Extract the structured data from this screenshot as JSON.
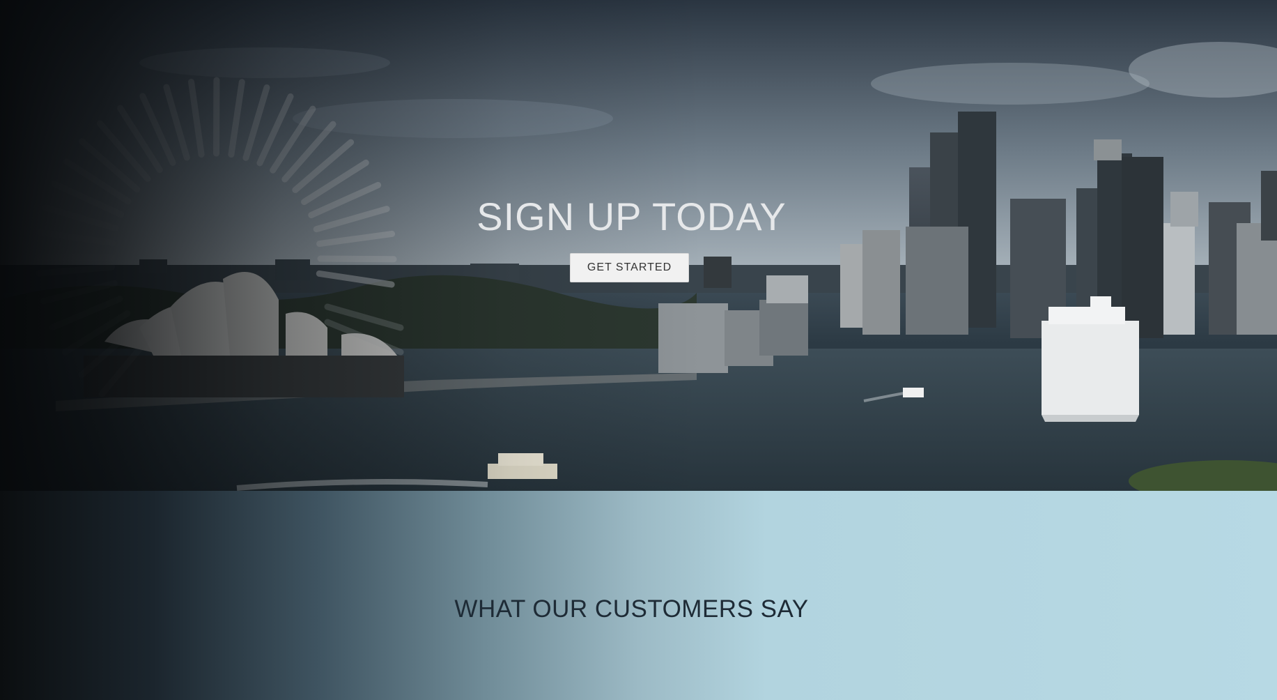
{
  "hero": {
    "title": "SIGN UP TODAY",
    "cta_label": "GET STARTED",
    "background_image": "sydney-harbour-skyline"
  },
  "testimonials": {
    "title": "WHAT OUR CUSTOMERS SAY"
  },
  "colors": {
    "hero_title": "#e6e8ea",
    "cta_background": "#f1f1f1",
    "section_title": "#1e2b36",
    "section_bg_light": "#b7d9e4"
  },
  "icons": [
    "loading-spinner-icon"
  ]
}
